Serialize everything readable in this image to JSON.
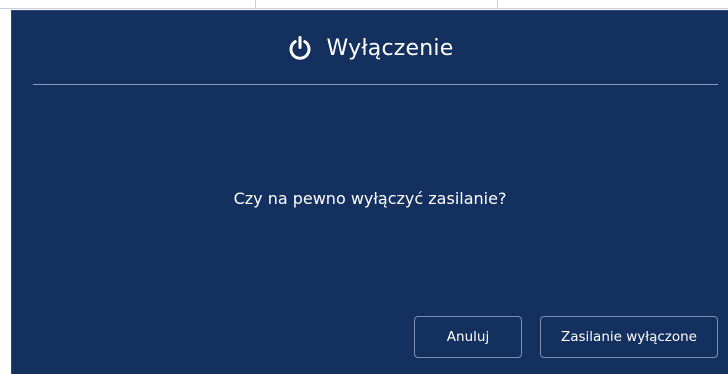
{
  "dialog": {
    "title": "Wyłączenie",
    "icon": "power-icon",
    "message": "Czy na pewno wyłączyć zasilanie?",
    "buttons": {
      "cancel_label": "Anuluj",
      "confirm_label": "Zasilanie wyłączone"
    }
  },
  "colors": {
    "dialog_background": "#13305f",
    "divider": "#8a9bb8",
    "button_border": "#7a90b8",
    "text": "#ffffff"
  }
}
